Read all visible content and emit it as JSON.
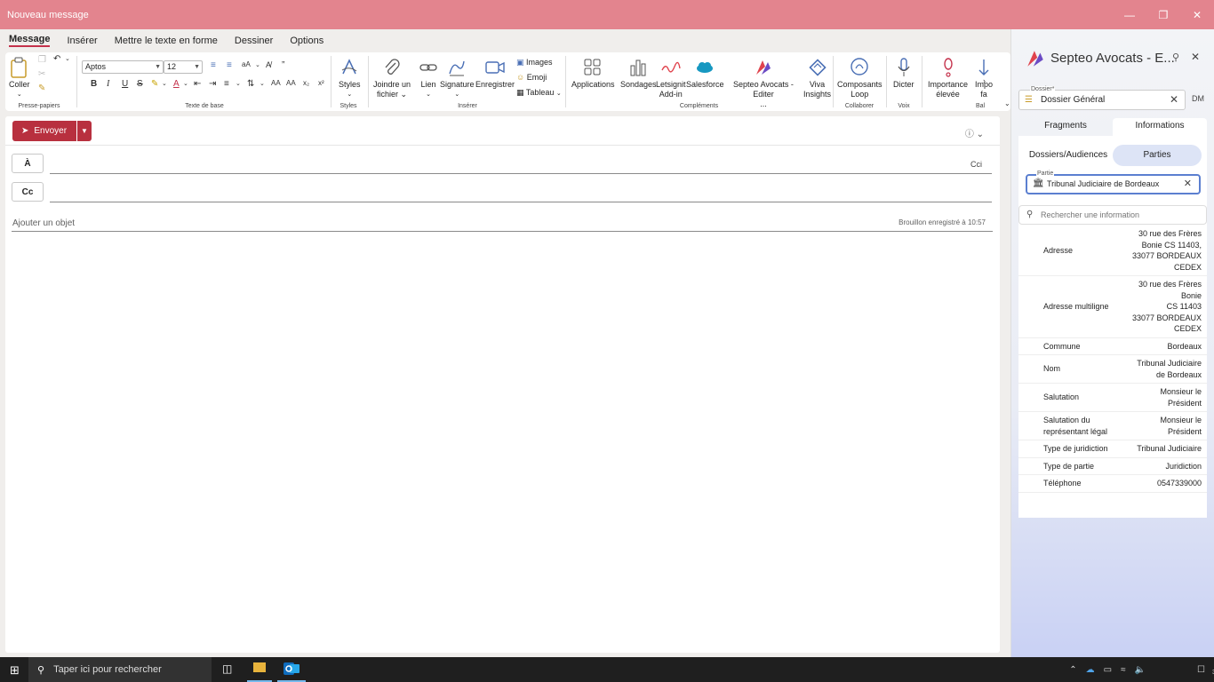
{
  "window": {
    "title": "Nouveau message"
  },
  "tabs": [
    "Message",
    "Insérer",
    "Mettre le texte en forme",
    "Dessiner",
    "Options"
  ],
  "ribbon": {
    "paste_label": "Coller",
    "group_clipboard": "Presse-papiers",
    "font_name": "Aptos",
    "font_size": "12",
    "group_basic_text": "Texte de base",
    "styles_label": "Styles",
    "group_styles": "Styles",
    "attach_label_1": "Joindre un",
    "attach_label_2": "fichier",
    "link_label": "Lien",
    "signature_label": "Signature",
    "record_label": "Enregistrer",
    "images_label": "Images",
    "emoji_label": "Emoji",
    "table_label": "Tableau",
    "group_insert": "Insérer",
    "apps_label": "Applications",
    "polls_label": "Sondages",
    "letsignit_label_1": "Letsignit",
    "letsignit_label_2": "Add-in",
    "salesforce_label": "Salesforce",
    "septeo_label_1": "Septeo Avocats - Editer",
    "septeo_label_2": "...",
    "viva_label_1": "Viva",
    "viva_label_2": "Insights",
    "group_addins": "Compléments",
    "loop_label_1": "Composants",
    "loop_label_2": "Loop",
    "group_collab": "Collaborer",
    "dictate_label": "Dicter",
    "group_voice": "Voix",
    "importance_label_1": "Importance",
    "importance_label_2": "élevée",
    "importance_low_label_1": "Impo",
    "importance_low_label_2": "fa",
    "group_tags": "Bal"
  },
  "compose": {
    "send_label": "Envoyer",
    "to_label": "À",
    "cc_label": "Cc",
    "bcc_label": "Cci",
    "subject_placeholder": "Ajouter un objet",
    "draft_status": "Brouillon enregistré à 10:57"
  },
  "pane": {
    "title": "Septeo Avocats - E...",
    "dossier_label": "Dossier",
    "dossier_required": "*",
    "dossier_value": "Dossier Général",
    "user_initials": "DM",
    "tabs": [
      "Fragments",
      "Informations"
    ],
    "active_tab": "Informations",
    "segments": [
      "Dossiers/Audiences",
      "Parties"
    ],
    "active_segment": "Parties",
    "partie_label": "Partie",
    "partie_value": "Tribunal Judiciaire de Bordeaux",
    "search_placeholder": "Rechercher une information",
    "rows": [
      {
        "key": "Adresse",
        "value": [
          "30 rue des Frères",
          "Bonie CS 11403,",
          "33077  BORDEAUX",
          "CEDEX"
        ]
      },
      {
        "key": "Adresse multiligne",
        "value": [
          "30 rue des Frères",
          "Bonie",
          "CS 11403",
          "33077  BORDEAUX",
          "CEDEX"
        ]
      },
      {
        "key": "Commune",
        "value": [
          "Bordeaux"
        ]
      },
      {
        "key": "Nom",
        "value": [
          "Tribunal Judiciaire",
          "de Bordeaux"
        ]
      },
      {
        "key": "Salutation",
        "value": [
          "Monsieur le",
          "Président"
        ]
      },
      {
        "key": "Salutation du représentant légal",
        "value": [
          "Monsieur le",
          "Président"
        ]
      },
      {
        "key": "Type de juridiction",
        "value": [
          "Tribunal Judiciaire"
        ]
      },
      {
        "key": "Type de partie",
        "value": [
          "Juridiction"
        ]
      },
      {
        "key": "Téléphone",
        "value": [
          "0547339000"
        ]
      }
    ]
  },
  "taskbar": {
    "search_placeholder": "Taper ici pour rechercher",
    "notification_count": "3"
  },
  "colors": {
    "titlebar": "#e3848e",
    "send": "#b8303f",
    "accent": "#5b7fd0"
  }
}
